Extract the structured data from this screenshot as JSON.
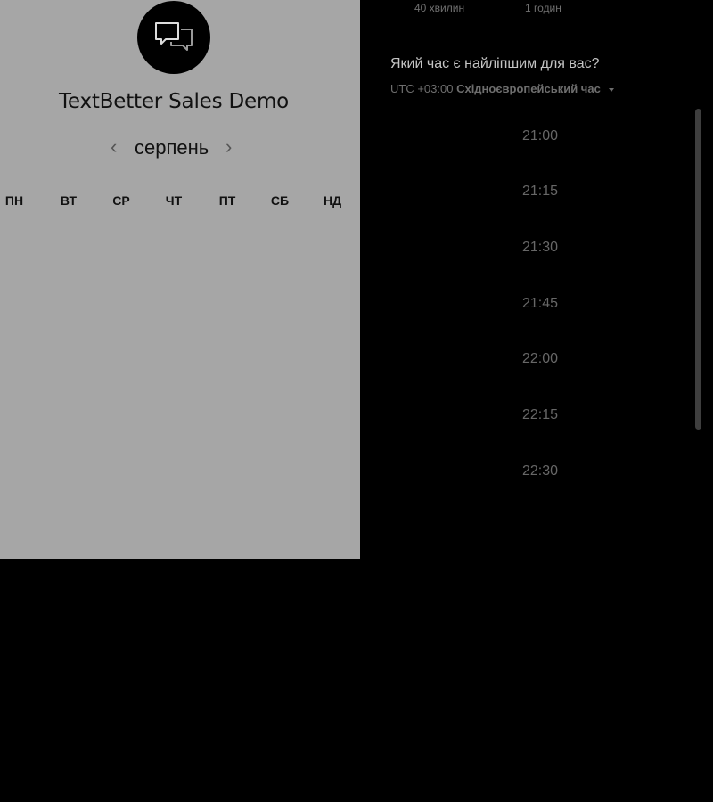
{
  "business": {
    "title": "TextBetter Sales Demo"
  },
  "calendar": {
    "month": "серпень",
    "prev_icon": "chevron-left-icon",
    "next_icon": "chevron-right-icon",
    "weekdays": [
      "ПН",
      "ВТ",
      "СР",
      "ЧТ",
      "ПТ",
      "СБ",
      "НД"
    ]
  },
  "durations": [
    {
      "label": "40 хвилин"
    },
    {
      "label": "1 годин"
    }
  ],
  "booking": {
    "question": "Який час є найліпшим для вас?",
    "timezone_offset": "UTC +03:00",
    "timezone_name": "Східноєвропейський час"
  },
  "times": [
    "21:00",
    "21:15",
    "21:30",
    "21:45",
    "22:00",
    "22:15",
    "22:30"
  ],
  "colors": {
    "page_background": "#000000",
    "left_panel_background": "#a6a6a6",
    "avatar_background": "#000000"
  }
}
